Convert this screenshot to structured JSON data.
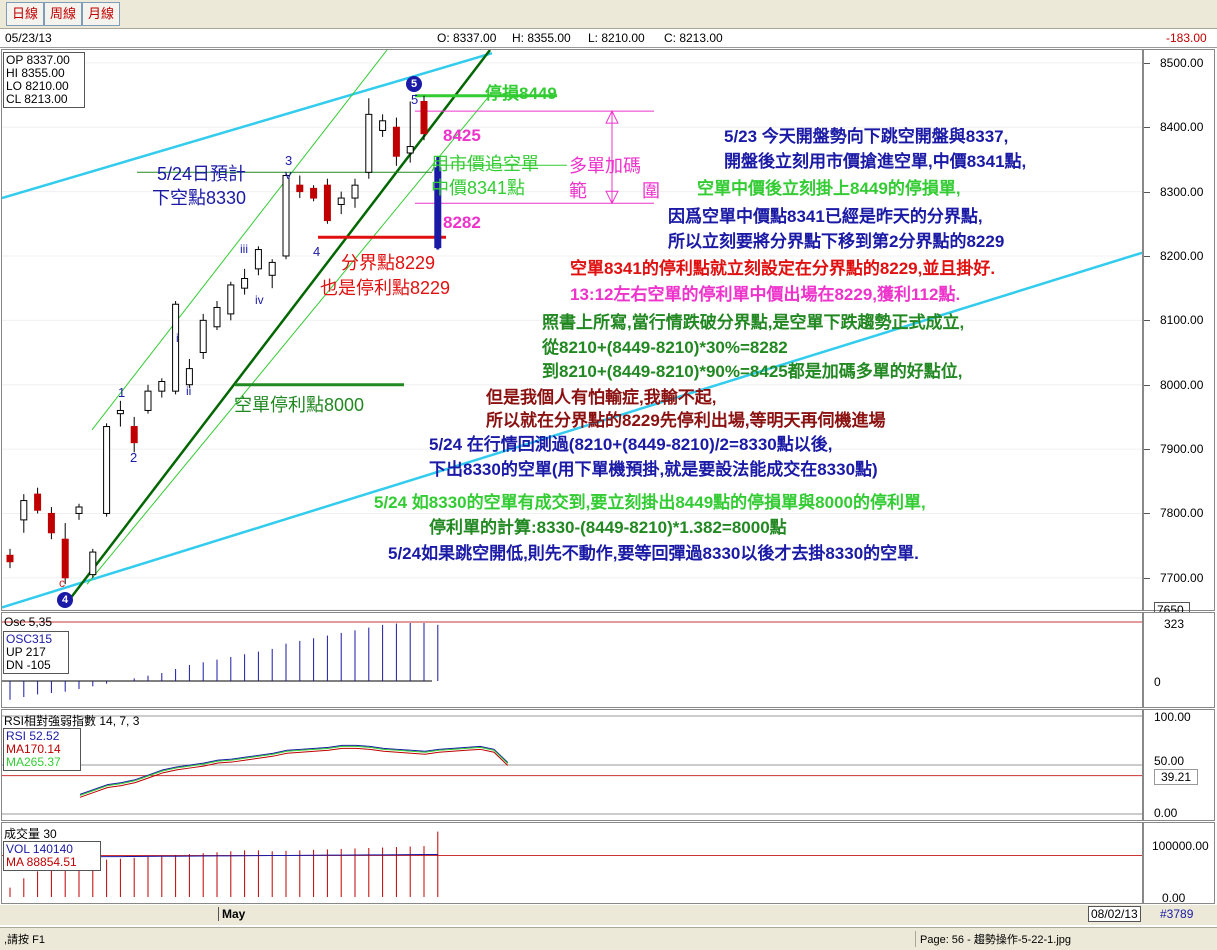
{
  "toolbar": {
    "tabs": [
      "日線",
      "周線",
      "月線"
    ]
  },
  "info": {
    "date": "05/23/13",
    "open": "O: 8337.00",
    "high": "H: 8355.00",
    "low": "L: 8210.00",
    "close": "C: 8213.00",
    "change": "-183.00"
  },
  "ohlc_box": {
    "op": "OP 8337.00",
    "hi": "HI  8355.00",
    "lo": "LO  8210.00",
    "cl": "CL  8213.00"
  },
  "price_axis": {
    "ticks": [
      "8500.00",
      "8400.00",
      "8300.00",
      "8200.00",
      "8100.00",
      "8000.00",
      "7900.00",
      "7800.00",
      "7700.00",
      "7650."
    ]
  },
  "wave_labels": {
    "w1": "1",
    "w2": "2",
    "w3": "3",
    "wv": "v",
    "w4": "4",
    "w5": "5",
    "w5circle": "5",
    "w4circle": "4",
    "wi": "i",
    "wii": "ii",
    "wiii": "iii",
    "wiv": "iv",
    "wc": "c"
  },
  "chart_labels": {
    "stop_loss": "停損8449",
    "level_8425": "8425",
    "level_8282": "8282",
    "add_long_1": "多單加碼",
    "add_long_2a": "範",
    "add_long_2b": "圍",
    "chase_short_1": "用市價追空單",
    "chase_short_2": "中價8341點",
    "forecast_1": "5/24日預計",
    "forecast_2": "下空點8330",
    "boundary_1": "分界點8229",
    "boundary_2": "也是停利點8229",
    "short_tp": "空單停利點8000"
  },
  "notes": [
    {
      "text": "5/23  今天開盤勢向下跳空開盤與8337,",
      "color": "#1a1aa6"
    },
    {
      "text": "開盤後立刻用市價搶進空單,中價8341點,",
      "color": "#1a1aa6"
    },
    {
      "text": "空單中價後立刻掛上8449的停損單,",
      "color": "#33cc33"
    },
    {
      "text": "因爲空單中價點8341已經是昨天的分界點,",
      "color": "#1a1aa6"
    },
    {
      "text": "所以立刻要將分界點下移到第2分界點的8229",
      "color": "#1a1aa6"
    },
    {
      "text": "空單8341的停利點就立刻設定在分界點的8229,並且掛好.",
      "color": "#e01010"
    },
    {
      "text": "13:12左右空單的停利單中價出場在8229,獲利112點.",
      "color": "#ee33cc"
    },
    {
      "text": "照書上所寫,當行情跌破分界點,是空單下跌趨勢正式成立,",
      "color": "#228822"
    },
    {
      "text": "從8210+(8449-8210)*30%=8282",
      "color": "#228822"
    },
    {
      "text": "到8210+(8449-8210)*90%=8425都是加碼多單的好點位,",
      "color": "#228822"
    },
    {
      "text": "但是我個人有怕輸症,我輸不起,",
      "color": "#8b1010"
    },
    {
      "text": "所以就在分界點的8229先停利出場,等明天再伺機進場",
      "color": "#8b1010"
    },
    {
      "text": "5/24  在行情回測過(8210+(8449-8210)/2=8330點以後,",
      "color": "#1a1aa6"
    },
    {
      "text": "下出8330的空單(用下單機預掛,就是要設法能成交在8330點)",
      "color": "#1a1aa6"
    },
    {
      "text": "5/24 如8330的空單有成交到,要立刻掛出8449點的停損單與8000的停利單,",
      "color": "#33cc33"
    },
    {
      "text": "停利單的計算:8330-(8449-8210)*1.382=8000點",
      "color": "#228822"
    },
    {
      "text": "5/24如果跳空開低,則先不動作,要等回彈過8330以後才去掛8330的空單.",
      "color": "#1a1aa6"
    }
  ],
  "osc_panel": {
    "title": "Osc 5,35",
    "osc": "OSC315",
    "up": "UP  217",
    "dn": "DN  -105",
    "axis_value": "323",
    "axis_zero": "0"
  },
  "rsi_panel": {
    "title": "RSI相對強弱指數",
    "params": "14, 7, 3",
    "rsi": "RSI  52.52",
    "ma1": "MA170.14",
    "ma2": "MA265.37",
    "axis_top": "100.00",
    "axis_mid": "50.00",
    "axis_val": "39.21",
    "axis_bot": "0.00"
  },
  "vol_panel": {
    "title": "成交量",
    "params": "30",
    "vol": "VOL 140140",
    "ma": "MA  88854.51",
    "axis_top": "100000.00",
    "axis_bot": "0.00"
  },
  "time_axis": {
    "month": "May",
    "end_date": "08/02/13",
    "count": "#3789"
  },
  "status": {
    "help": ",請按 F1",
    "page": "Page: 56 - 趨勢操作-5-22-1.jpg"
  },
  "chart_data": {
    "type": "candlestick",
    "y_axis": {
      "min": 7650,
      "max": 8520
    },
    "candles": [
      {
        "o": 7735,
        "h": 7745,
        "l": 7715,
        "c": 7725
      },
      {
        "o": 7790,
        "h": 7830,
        "l": 7770,
        "c": 7820
      },
      {
        "o": 7830,
        "h": 7840,
        "l": 7800,
        "c": 7805
      },
      {
        "o": 7800,
        "h": 7810,
        "l": 7760,
        "c": 7770
      },
      {
        "o": 7760,
        "h": 7785,
        "l": 7690,
        "c": 7700
      },
      {
        "o": 7800,
        "h": 7815,
        "l": 7790,
        "c": 7810
      },
      {
        "o": 7705,
        "h": 7745,
        "l": 7700,
        "c": 7740
      },
      {
        "o": 7800,
        "h": 7940,
        "l": 7795,
        "c": 7935
      },
      {
        "o": 7955,
        "h": 7975,
        "l": 7935,
        "c": 7960
      },
      {
        "o": 7935,
        "h": 7950,
        "l": 7895,
        "c": 7910
      },
      {
        "o": 7960,
        "h": 8000,
        "l": 7955,
        "c": 7990
      },
      {
        "o": 7990,
        "h": 8010,
        "l": 7980,
        "c": 8005
      },
      {
        "o": 7990,
        "h": 8130,
        "l": 7985,
        "c": 8125
      },
      {
        "o": 8000,
        "h": 8040,
        "l": 7995,
        "c": 8025
      },
      {
        "o": 8050,
        "h": 8110,
        "l": 8040,
        "c": 8100
      },
      {
        "o": 8090,
        "h": 8130,
        "l": 8085,
        "c": 8120
      },
      {
        "o": 8110,
        "h": 8160,
        "l": 8100,
        "c": 8155
      },
      {
        "o": 8150,
        "h": 8180,
        "l": 8140,
        "c": 8165
      },
      {
        "o": 8180,
        "h": 8215,
        "l": 8170,
        "c": 8210
      },
      {
        "o": 8170,
        "h": 8195,
        "l": 8150,
        "c": 8190
      },
      {
        "o": 8200,
        "h": 8330,
        "l": 8195,
        "c": 8325
      },
      {
        "o": 8310,
        "h": 8325,
        "l": 8290,
        "c": 8300
      },
      {
        "o": 8305,
        "h": 8310,
        "l": 8285,
        "c": 8290
      },
      {
        "o": 8310,
        "h": 8320,
        "l": 8250,
        "c": 8255
      },
      {
        "o": 8280,
        "h": 8300,
        "l": 8265,
        "c": 8290
      },
      {
        "o": 8290,
        "h": 8320,
        "l": 8275,
        "c": 8310
      },
      {
        "o": 8330,
        "h": 8445,
        "l": 8320,
        "c": 8420
      },
      {
        "o": 8395,
        "h": 8420,
        "l": 8385,
        "c": 8410
      },
      {
        "o": 8400,
        "h": 8415,
        "l": 8340,
        "c": 8355
      },
      {
        "o": 8360,
        "h": 8440,
        "l": 8345,
        "c": 8370
      },
      {
        "o": 8440,
        "h": 8449,
        "l": 8380,
        "c": 8390
      },
      {
        "o": 8337,
        "h": 8355,
        "l": 8210,
        "c": 8213
      }
    ],
    "levels": [
      {
        "name": "停損8449",
        "value": 8449
      },
      {
        "name": "8425",
        "value": 8425
      },
      {
        "name": "中價8341點",
        "value": 8341
      },
      {
        "name": "下空點8330",
        "value": 8330
      },
      {
        "name": "8282",
        "value": 8282
      },
      {
        "name": "分界點8229",
        "value": 8229
      },
      {
        "name": "空單停利點8000",
        "value": 8000
      }
    ],
    "osc": [
      -70,
      -60,
      -50,
      -45,
      -40,
      -30,
      -20,
      -10,
      0,
      10,
      20,
      30,
      45,
      60,
      70,
      80,
      90,
      100,
      110,
      120,
      140,
      150,
      160,
      170,
      180,
      190,
      200,
      210,
      215,
      217,
      217,
      210
    ],
    "rsi": [
      20,
      25,
      30,
      32,
      35,
      40,
      45,
      48,
      50,
      52,
      55,
      56,
      58,
      60,
      62,
      65,
      66,
      67,
      68,
      70,
      70,
      69,
      67,
      66,
      65,
      64,
      66,
      67,
      68,
      69,
      66,
      52.52
    ],
    "volume": [
      20000,
      40000,
      55000,
      60000,
      65000,
      70000,
      75000,
      80000,
      82000,
      84000,
      86000,
      88000,
      90000,
      92000,
      94000,
      96000,
      98000,
      100000,
      100000,
      98000,
      99000,
      100000,
      101000,
      102000,
      103000,
      104000,
      105000,
      106000,
      107000,
      108000,
      109000,
      140140
    ]
  }
}
